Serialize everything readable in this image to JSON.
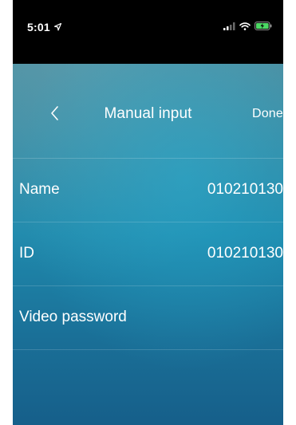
{
  "status_bar": {
    "time": "5:01",
    "background": "#000000"
  },
  "nav": {
    "back_icon": "chevron-left-icon",
    "title": "Manual input",
    "done_label": "Done"
  },
  "rows": [
    {
      "label": "Name",
      "value": "010210130"
    },
    {
      "label": "ID",
      "value": "010210130"
    },
    {
      "label": "Video password",
      "value": ""
    }
  ],
  "colors": {
    "text": "#ffffff",
    "background_top": "#5d8f9c",
    "background_mid": "#1f8aad",
    "background_bottom": "#165f8a"
  }
}
